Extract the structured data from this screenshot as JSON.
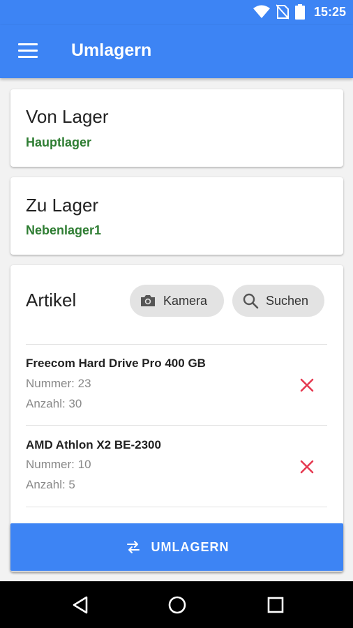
{
  "status_bar": {
    "time": "15:25",
    "icons": [
      "wifi-icon",
      "no-sim-icon",
      "battery-icon"
    ]
  },
  "app_bar": {
    "title": "Umlagern",
    "menu_icon": "menu-icon"
  },
  "from_card": {
    "title": "Von Lager",
    "value": "Hauptlager"
  },
  "to_card": {
    "title": "Zu Lager",
    "value": "Nebenlager1"
  },
  "articles": {
    "title": "Artikel",
    "camera_label": "Kamera",
    "search_label": "Suchen",
    "items": [
      {
        "name": "Freecom Hard Drive Pro 400 GB",
        "number": "Nummer: 23",
        "quantity": "Anzahl: 30"
      },
      {
        "name": "AMD Athlon X2 BE-2300",
        "number": "Nummer: 10",
        "quantity": "Anzahl: 5"
      }
    ]
  },
  "action_button": {
    "label": "UMLAGERN",
    "icon": "swap-icon"
  },
  "nav_bar": {
    "buttons": [
      "back-icon",
      "home-icon",
      "recents-icon"
    ]
  },
  "colors": {
    "primary": "#3d84f4",
    "value_green": "#2e7d32",
    "delete_red": "#e53950"
  }
}
